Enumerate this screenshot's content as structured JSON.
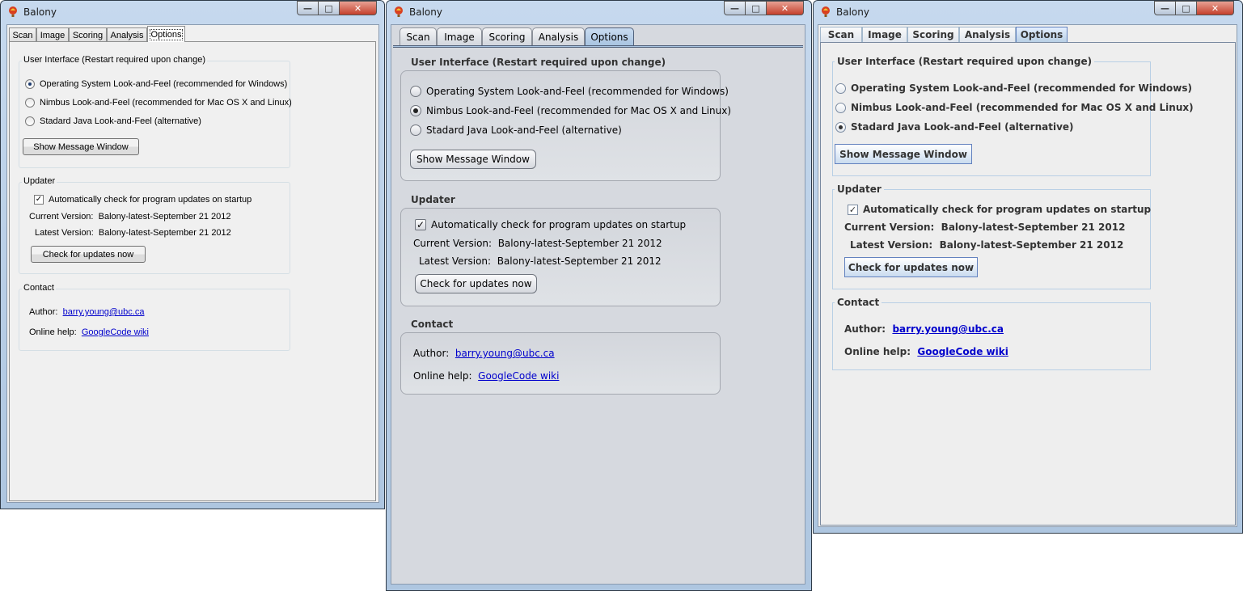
{
  "windows": [
    {
      "title": "Balony",
      "tabs": [
        "Scan",
        "Image",
        "Scoring",
        "Analysis",
        "Options"
      ],
      "selected_tab": "Options",
      "ui_group_title": "User Interface (Restart required upon change)",
      "lookfeel_options": [
        {
          "label": "Operating System Look-and-Feel (recommended for Windows)",
          "selected": true
        },
        {
          "label": "Nimbus Look-and-Feel (recommended for Mac OS X and Linux)",
          "selected": false
        },
        {
          "label": "Stadard Java Look-and-Feel (alternative)",
          "selected": false
        }
      ],
      "show_message_button": "Show Message Window",
      "updater_title": "Updater",
      "auto_check_label": "Automatically check for program updates on startup",
      "auto_check_checked": true,
      "current_version_label": "Current Version:",
      "current_version_value": "Balony-latest-September 21 2012",
      "latest_version_label": "Latest Version:",
      "latest_version_value": "Balony-latest-September 21 2012",
      "check_updates_button": "Check for updates now",
      "contact_title": "Contact",
      "author_label": "Author:",
      "author_link": "barry.young@ubc.ca",
      "help_label": "Online help:",
      "help_link": "GoogleCode wiki"
    },
    {
      "title": "Balony",
      "tabs": [
        "Scan",
        "Image",
        "Scoring",
        "Analysis",
        "Options"
      ],
      "selected_tab": "Options",
      "ui_group_title": "User Interface (Restart required upon change)",
      "lookfeel_options": [
        {
          "label": "Operating System Look-and-Feel (recommended for Windows)",
          "selected": false
        },
        {
          "label": "Nimbus Look-and-Feel (recommended for Mac OS X and Linux)",
          "selected": true
        },
        {
          "label": "Stadard Java Look-and-Feel (alternative)",
          "selected": false
        }
      ],
      "show_message_button": "Show Message Window",
      "updater_title": "Updater",
      "auto_check_label": "Automatically check for program updates on startup",
      "auto_check_checked": true,
      "current_version_label": "Current Version:",
      "current_version_value": "Balony-latest-September 21 2012",
      "latest_version_label": "Latest Version:",
      "latest_version_value": "Balony-latest-September 21 2012",
      "check_updates_button": "Check for updates now",
      "contact_title": "Contact",
      "author_label": "Author:",
      "author_link": "barry.young@ubc.ca",
      "help_label": "Online help:",
      "help_link": "GoogleCode wiki"
    },
    {
      "title": "Balony",
      "tabs": [
        "Scan",
        "Image",
        "Scoring",
        "Analysis",
        "Options"
      ],
      "selected_tab": "Options",
      "ui_group_title": "User Interface (Restart required upon change)",
      "lookfeel_options": [
        {
          "label": "Operating System Look-and-Feel (recommended for Windows)",
          "selected": false
        },
        {
          "label": "Nimbus Look-and-Feel (recommended for Mac OS X and Linux)",
          "selected": false
        },
        {
          "label": "Stadard Java Look-and-Feel (alternative)",
          "selected": true
        }
      ],
      "show_message_button": "Show Message Window",
      "updater_title": "Updater",
      "auto_check_label": "Automatically check for program updates on startup",
      "auto_check_checked": true,
      "current_version_label": "Current Version:",
      "current_version_value": "Balony-latest-September 21 2012",
      "latest_version_label": "Latest Version:",
      "latest_version_value": "Balony-latest-September 21 2012",
      "check_updates_button": "Check for updates now",
      "contact_title": "Contact",
      "author_label": "Author:",
      "author_link": "barry.young@ubc.ca",
      "help_label": "Online help:",
      "help_link": "GoogleCode wiki"
    }
  ],
  "icons": {
    "app": "balloon-icon",
    "minimize": "minimize-icon",
    "maximize": "maximize-icon",
    "close": "close-icon",
    "check": "checkmark-icon"
  },
  "colors": {
    "link": "#0000cc",
    "close_button": "#c4402c",
    "nimbus_selected_tab": "#a9c4e1"
  }
}
